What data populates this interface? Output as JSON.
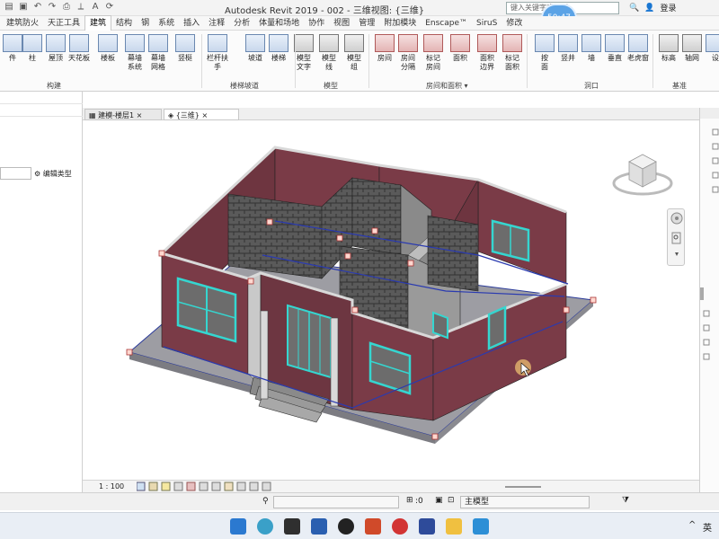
{
  "window": {
    "title": "Autodesk Revit 2019 - 002 - 三维视图: {三维}",
    "search_placeholder": "键入关键字或短语",
    "time_bubble": "50:47",
    "login_label": "登录"
  },
  "ribbon_tabs": [
    "建筑防火",
    "天正工具",
    "建筑",
    "结构",
    "钢",
    "系统",
    "插入",
    "注释",
    "分析",
    "体量和场地",
    "协作",
    "视图",
    "管理",
    "附加模块",
    "Enscape™",
    "SiruS",
    "修改"
  ],
  "active_tab": "建筑",
  "ribbon": {
    "tools": [
      {
        "label": "件",
        "icon": "component-icon"
      },
      {
        "label": "柱",
        "icon": "column-icon"
      },
      {
        "label": "屋顶",
        "icon": "roof-icon"
      },
      {
        "label": "天花板",
        "icon": "ceiling-icon"
      },
      {
        "label": "楼板",
        "icon": "floor-icon"
      },
      {
        "label": "幕墙\n系统",
        "icon": "curtain-system-icon"
      },
      {
        "label": "幕墙\n网格",
        "icon": "curtain-grid-icon"
      },
      {
        "label": "竖梃",
        "icon": "mullion-icon"
      },
      {
        "label": "栏杆扶手",
        "icon": "railing-icon"
      },
      {
        "label": "坡道",
        "icon": "ramp-icon"
      },
      {
        "label": "楼梯",
        "icon": "stair-icon"
      },
      {
        "label": "模型\n文字",
        "icon": "model-text-icon"
      },
      {
        "label": "模型\n线",
        "icon": "model-line-icon"
      },
      {
        "label": "模型\n组",
        "icon": "model-group-icon"
      },
      {
        "label": "房间",
        "icon": "room-icon"
      },
      {
        "label": "房间\n分隔",
        "icon": "room-separator-icon"
      },
      {
        "label": "标记\n房间",
        "icon": "tag-room-icon"
      },
      {
        "label": "面积",
        "icon": "area-icon"
      },
      {
        "label": "面积\n边界",
        "icon": "area-boundary-icon"
      },
      {
        "label": "标记\n面积",
        "icon": "tag-area-icon"
      },
      {
        "label": "按\n面",
        "icon": "by-face-icon"
      },
      {
        "label": "竖井",
        "icon": "shaft-icon"
      },
      {
        "label": "墙",
        "icon": "wall-opening-icon"
      },
      {
        "label": "垂直",
        "icon": "vertical-opening-icon"
      },
      {
        "label": "老虎窗",
        "icon": "dormer-icon"
      },
      {
        "label": "标高",
        "icon": "level-icon"
      },
      {
        "label": "轴网",
        "icon": "grid-icon"
      },
      {
        "label": "设",
        "icon": "set-icon"
      }
    ],
    "panels": [
      "构建",
      "楼梯坡道",
      "模型",
      "房间和面积 ▾",
      "洞口",
      "基准"
    ]
  },
  "properties": {
    "edit_type_label": "编辑类型"
  },
  "view_tabs": [
    {
      "label": "建模-楼层1",
      "active": false
    },
    {
      "label": "{三维}",
      "active": true
    }
  ],
  "view_control": {
    "scale": "1 : 100"
  },
  "status": {
    "selection_count": ":0",
    "model_label": "主模型"
  },
  "taskbar": {
    "ime_label": "英"
  },
  "colors": {
    "wall_exterior": "#7a3b47",
    "wall_top": "#c9c9c9",
    "brick": "#5a5a5a",
    "window_frame": "#35d6d0",
    "slab": "#9d9da3",
    "accent": "#2b79d0"
  }
}
